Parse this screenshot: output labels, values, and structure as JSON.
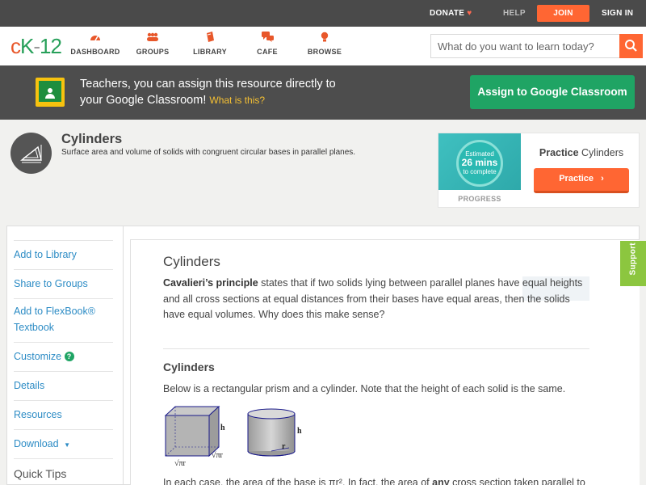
{
  "topbar": {
    "donate": "DONATE",
    "help": "HELP",
    "join": "JOIN",
    "signin": "SIGN IN"
  },
  "logo": {
    "c": "c",
    "k": "K",
    "dash": "-",
    "num": "12"
  },
  "nav": {
    "items": [
      {
        "label": "DASHBOARD",
        "icon": "dashboard-icon"
      },
      {
        "label": "GROUPS",
        "icon": "groups-icon"
      },
      {
        "label": "LIBRARY",
        "icon": "library-icon"
      },
      {
        "label": "CAFE",
        "icon": "cafe-icon"
      },
      {
        "label": "BROWSE",
        "icon": "browse-icon"
      }
    ],
    "search_placeholder": "What do you want to learn today?"
  },
  "classroom": {
    "line1": "Teachers, you can assign this resource directly to",
    "line2": "your Google Classroom!",
    "what": "What is this?",
    "button": "Assign to Google Classroom"
  },
  "concept": {
    "title": "Cylinders",
    "description": "Surface area and volume of solids with congruent circular bases in parallel planes."
  },
  "progress": {
    "estimated": "Estimated",
    "minutes": "26 mins",
    "to_complete": "to complete",
    "label": "PROGRESS",
    "practice_bold": "Practice",
    "practice_topic": "Cylinders",
    "practice_button": "Practice"
  },
  "sidebar": {
    "items": [
      "Add to Library",
      "Share to Groups",
      "Add to FlexBook®",
      "Textbook",
      "Customize",
      "Details",
      "Resources",
      "Download"
    ],
    "quick_tips": "Quick Tips"
  },
  "content": {
    "heading": "Cylinders",
    "para_bold": "Cavalieri’s principle",
    "para_rest": " states that if two solids lying between parallel planes have equal heights and all cross sections at equal distances from their bases have equal areas, then the solids have equal volumes. Why does this make sense?",
    "subheading": "Cylinders",
    "sentence": "Below is a rectangular prism and a cylinder. Note that the height of each solid is the same.",
    "fig_prism_h": "h",
    "fig_prism_w1": "√πr",
    "fig_prism_w2": "√πr",
    "fig_cyl_h": "h",
    "fig_cyl_r": "r",
    "tail_a": "In each case, the area of the base is ",
    "tail_expr": "πr²",
    "tail_b": ". In fact, the area of ",
    "tail_any": "any",
    "tail_c": " cross section taken parallel to"
  },
  "support": "Support",
  "colors": {
    "accent": "#ff6633",
    "green": "#1fa464",
    "link": "#2d8cc5"
  }
}
